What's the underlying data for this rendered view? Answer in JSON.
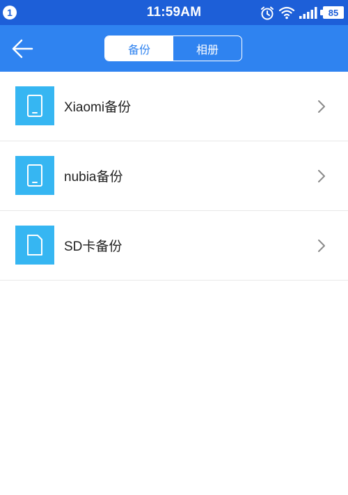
{
  "status_bar": {
    "notification_count": "1",
    "time": "11:59AM",
    "battery": "85",
    "icons": [
      "alarm-icon",
      "wifi-icon",
      "signal-icon",
      "battery-icon"
    ]
  },
  "app_bar": {
    "back_icon": "back-arrow-icon",
    "tabs": [
      {
        "label": "备份",
        "active": true
      },
      {
        "label": "相册",
        "active": false
      }
    ]
  },
  "list": [
    {
      "label": "Xiaomi备份",
      "icon": "phone-icon"
    },
    {
      "label": "nubia备份",
      "icon": "phone-icon"
    },
    {
      "label": "SD卡备份",
      "icon": "sd-card-icon"
    }
  ],
  "colors": {
    "status_bar": "#1d5fd8",
    "app_bar": "#2f83f0",
    "tile": "#36b6f2",
    "divider": "#e8e8e8"
  }
}
